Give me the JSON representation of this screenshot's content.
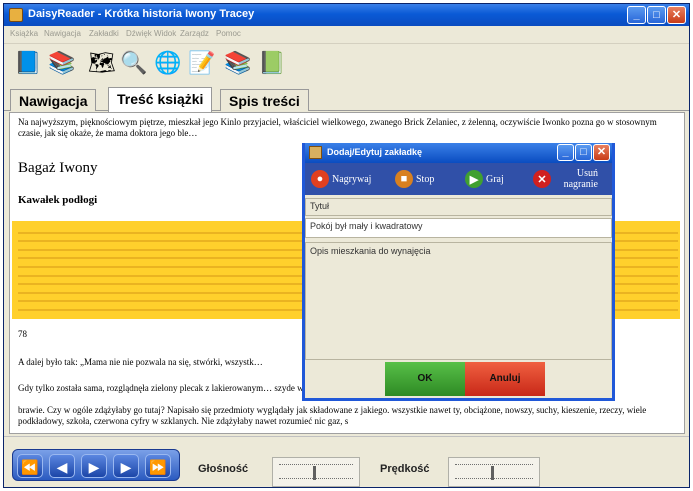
{
  "window": {
    "title": "DaisyReader - Krótka historia Iwony Tracey",
    "minimize": "_",
    "maximize": "□",
    "close": "✕"
  },
  "menu": [
    "Książka",
    "Nawigacja",
    "Zakładki",
    "Dźwięk",
    "Widok",
    "Zarządz",
    "Pomoc"
  ],
  "toolbar_icons": [
    {
      "name": "open-book-icon",
      "glyph": "📘"
    },
    {
      "name": "books-icon",
      "glyph": "📚"
    },
    {
      "name": "map-icon",
      "glyph": "🗺"
    },
    {
      "name": "magnifier-icon",
      "glyph": "🔍"
    },
    {
      "name": "globe-icon",
      "glyph": "🌐"
    },
    {
      "name": "note-icon",
      "glyph": "📝"
    },
    {
      "name": "bookshelf-icon",
      "glyph": "📚"
    },
    {
      "name": "books-stack-icon",
      "glyph": "📗"
    }
  ],
  "tabs": [
    {
      "label": "Nawigacja",
      "active": false
    },
    {
      "label": "Treść książki",
      "active": true
    },
    {
      "label": "Spis treści",
      "active": false
    }
  ],
  "book": {
    "intro": "Na najwyższym, pięknościowym piętrze, mieszkał jego Kinlo przyjaciel, właściciel wielkowego, zwanego Brick Zelaniec, z żelenną, oczywiście Iwonko pozna go w stosownym czasie, jak się okaże, że mama doktora jego ble…",
    "heading1": "Bagaż Iwony",
    "heading2": "Kawałek podłogi",
    "page_num": "78",
    "line_a": "A dalej było tak: „Mama nie nie pozwala na się, stwórki, wszystk…",
    "line_b": "Gdy tylko została sama, rozglądnęła zielony plecak z lakierowanym… szyde wciąż w sobą podłogi. Codziennie, ciągi do szkoły, pasowała go tam…",
    "line_c": "brawie. Czy w ogóle zdążyłaby go tutaj? Napisało się przedmioty wyglądały jak składowane z jakiego. wszystkie nawet ty, obciążone, nowszy, suchy, kieszenie, rzeczy, wiele podkładowy, szkoła, czerwona cyfry w szklanych. Nie zdążyłaby nawet rozumieć nic gaz, s"
  },
  "dialog": {
    "title": "Dodaj/Edytuj zakładkę",
    "record_label": "Nagrywaj",
    "stop_label": "Stop",
    "play_label": "Graj",
    "delete_label": "Usuń nagranie",
    "field_type": "Tytuł",
    "field_title_value": "Pokój był mały i kwadratowy",
    "note_value": "Opis mieszkania do wynajęcia",
    "ok_label": "OK",
    "cancel_label": "Anuluj"
  },
  "player": {
    "volume_label": "Głośność",
    "speed_label": "Prędkość"
  }
}
